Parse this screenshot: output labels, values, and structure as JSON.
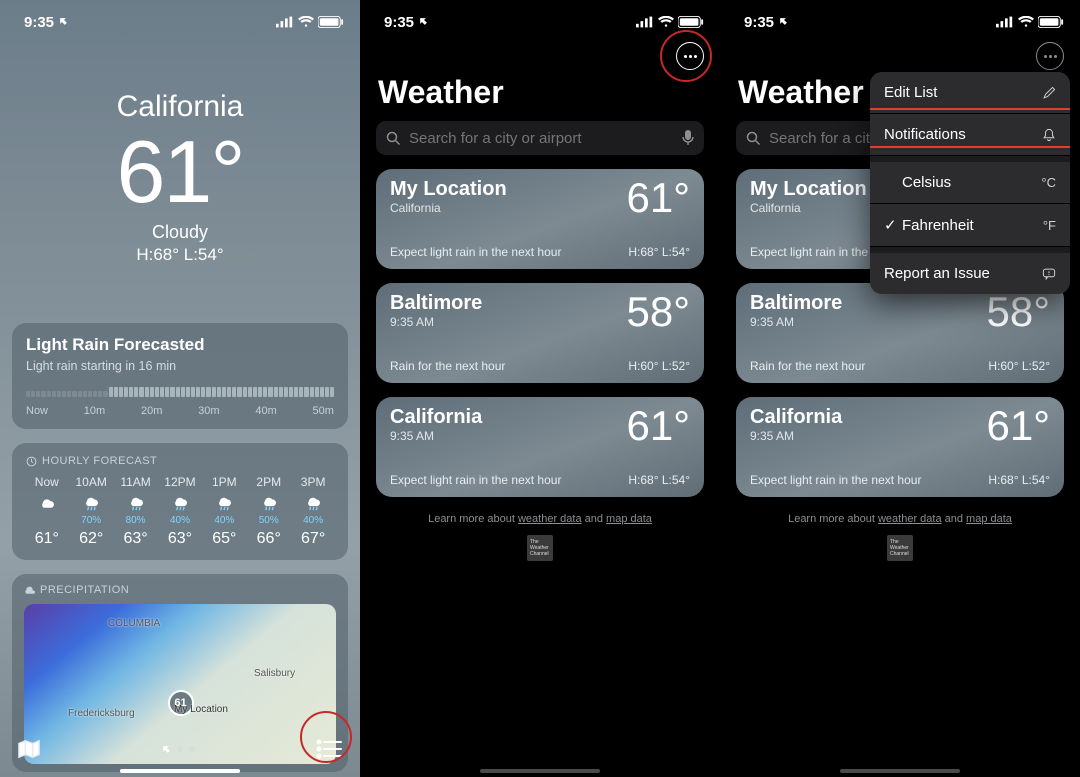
{
  "status": {
    "time": "9:35"
  },
  "pane1": {
    "location": "California",
    "temp": "61°",
    "condition": "Cloudy",
    "hl": "H:68°  L:54°",
    "rain": {
      "title": "Light Rain Forecasted",
      "sub": "Light rain starting in 16 min",
      "labels": [
        "Now",
        "10m",
        "20m",
        "30m",
        "40m",
        "50m"
      ]
    },
    "hourly_head": "HOURLY FORECAST",
    "hourly": [
      {
        "t": "Now",
        "pct": "",
        "temp": "61°",
        "icon": "cloud"
      },
      {
        "t": "10AM",
        "pct": "70%",
        "temp": "62°",
        "icon": "rain"
      },
      {
        "t": "11AM",
        "pct": "80%",
        "temp": "63°",
        "icon": "rain"
      },
      {
        "t": "12PM",
        "pct": "40%",
        "temp": "63°",
        "icon": "rain"
      },
      {
        "t": "1PM",
        "pct": "40%",
        "temp": "65°",
        "icon": "rain"
      },
      {
        "t": "2PM",
        "pct": "50%",
        "temp": "66°",
        "icon": "rain"
      },
      {
        "t": "3PM",
        "pct": "40%",
        "temp": "67°",
        "icon": "rain"
      }
    ],
    "precip_head": "PRECIPITATION",
    "map": {
      "col_label": "COLUMBIA",
      "fred": "Fredericksburg",
      "sal": "Salisbury",
      "pin": "61",
      "pin_sub": "My Location"
    }
  },
  "list": {
    "title": "Weather",
    "search_ph": "Search for a city or airport",
    "cities": [
      {
        "name": "My Location",
        "sub": "California",
        "temp": "61°",
        "desc": "Expect light rain in the next hour",
        "hl": "H:68°  L:54°"
      },
      {
        "name": "Baltimore",
        "sub": "9:35 AM",
        "temp": "58°",
        "desc": "Rain for the next hour",
        "hl": "H:60°  L:52°"
      },
      {
        "name": "California",
        "sub": "9:35 AM",
        "temp": "61°",
        "desc": "Expect light rain in the next hour",
        "hl": "H:68°  L:54°"
      }
    ],
    "foot": {
      "pre": "Learn more about ",
      "wd": "weather data",
      "and": " and ",
      "md": "map data"
    }
  },
  "menu": {
    "edit": "Edit List",
    "notif": "Notifications",
    "cel": "Celsius",
    "cel_g": "°C",
    "far": "Fahrenheit",
    "far_g": "°F",
    "report": "Report an Issue"
  },
  "pane3_search_visible": "Search for a city or"
}
